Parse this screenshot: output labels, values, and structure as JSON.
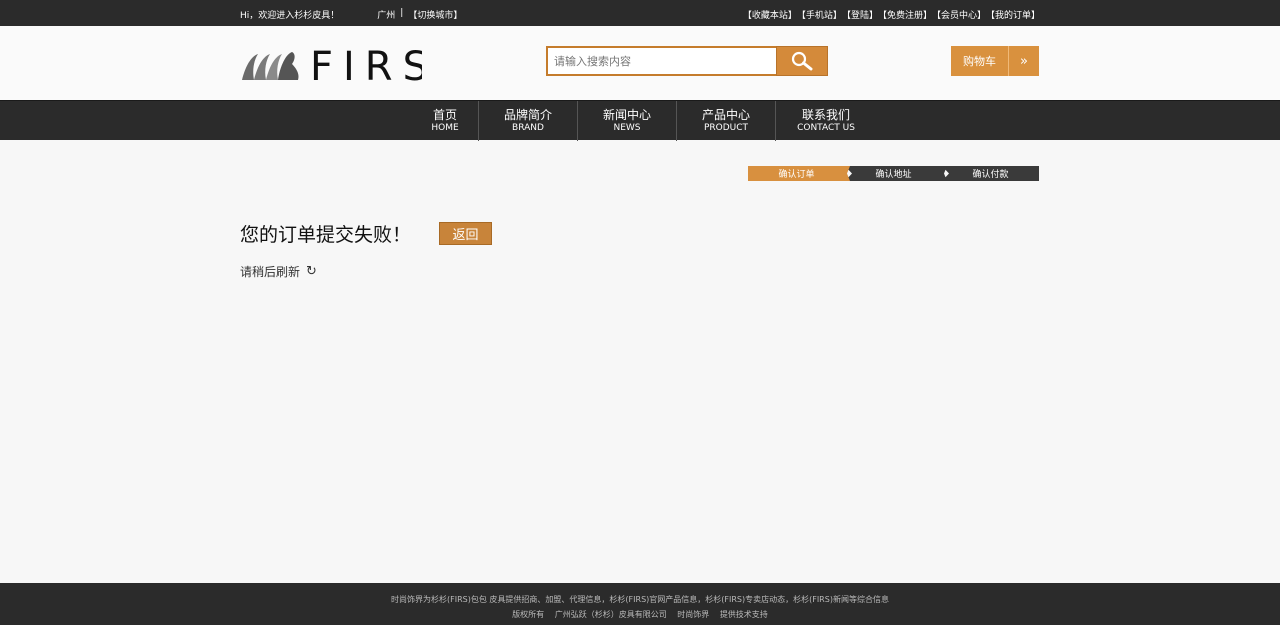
{
  "topbar": {
    "welcome": "Hi，欢迎进入杉杉皮具！",
    "city": "广州",
    "separator": "|",
    "switch_city": "【切换城市】",
    "links": [
      "【收藏本站】",
      "【手机站】",
      "【登陆】",
      "【免费注册】",
      "【会员中心】",
      "【我的订单】"
    ]
  },
  "header": {
    "logo_text": "FIRS",
    "search_placeholder": "请输入搜索内容",
    "cart_label": "购物车",
    "cart_arrow": "»"
  },
  "nav": [
    {
      "cn": "首页",
      "en": "HOME"
    },
    {
      "cn": "品牌简介",
      "en": "BRAND"
    },
    {
      "cn": "新闻中心",
      "en": "NEWS"
    },
    {
      "cn": "产品中心",
      "en": "PRODUCT"
    },
    {
      "cn": "联系我们",
      "en": "CONTACT US"
    }
  ],
  "steps": [
    "确认订单",
    "确认地址",
    "确认付款"
  ],
  "main": {
    "title": "您的订单提交失败！",
    "back_label": "返回",
    "subtitle": "请稍后刷新",
    "refresh_icon": "↻"
  },
  "footer": {
    "line1": "时尚饰界为杉杉(FIRS)包包 皮具提供招商、加盟、代理信息，杉杉(FIRS)官网产品信息，杉杉(FIRS)专卖店动态，杉杉(FIRS)新闻等综合信息",
    "line2": [
      "版权所有",
      "广州弘跃（杉杉）皮具有限公司",
      "时尚饰界",
      "提供技术支持"
    ]
  },
  "colors": {
    "accent": "#d8903f",
    "dark": "#2b2b2b",
    "background": "#f7f7f7"
  }
}
